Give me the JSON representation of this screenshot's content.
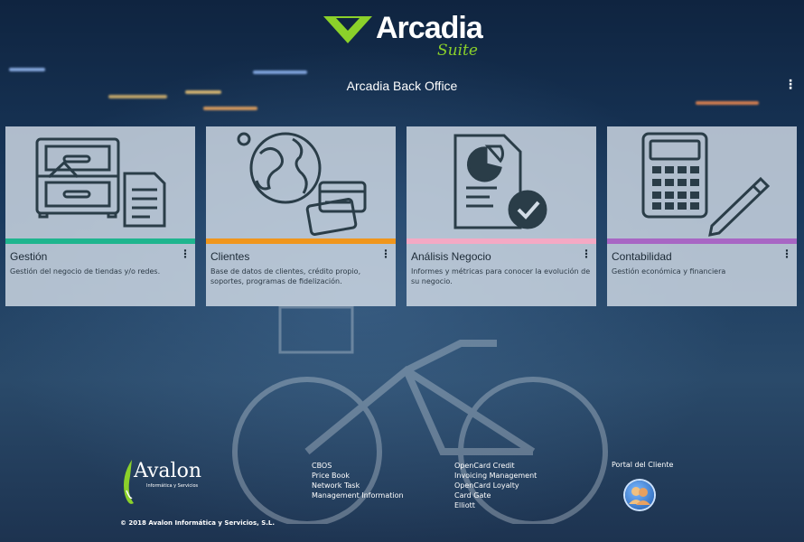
{
  "app": {
    "logo_name": "Arcadia",
    "logo_suite": "Suite",
    "title": "Arcadia Back Office",
    "menu_icon": "kebab-menu-icon"
  },
  "cards": [
    {
      "title": "Gestión",
      "description": "Gestión del negocio de tiendas y/o redes.",
      "accent": "#1fb58f",
      "icon": "cabinet-document-icon"
    },
    {
      "title": "Clientes",
      "description": "Base de datos de clientes, crédito propio, soportes, programas de fidelización.",
      "accent": "#f0961c",
      "icon": "globe-cards-icon"
    },
    {
      "title": "Análisis Negocio",
      "description": "Informes y métricas para conocer la evolución de su negocio.",
      "accent": "#f4a9c4",
      "icon": "report-chart-check-icon"
    },
    {
      "title": "Contabilidad",
      "description": "Gestión económica y financiera",
      "accent": "#a866c4",
      "icon": "calculator-pencil-icon"
    }
  ],
  "footer": {
    "logo_name": "Avalon",
    "logo_sub": "Informática y Servicios",
    "copyright": "© 2018 Avalon Informática y Servicios, S.L.",
    "links_col1": [
      "CBOS",
      "Price Book",
      "Network Task",
      "Management Information"
    ],
    "links_col2": [
      "OpenCard Credit",
      "Invoicing Management",
      "OpenCard Loyalty",
      "Card Gate",
      "Elliott"
    ],
    "portal_label": "Portal del Cliente",
    "portal_icon": "customer-portal-icon"
  }
}
